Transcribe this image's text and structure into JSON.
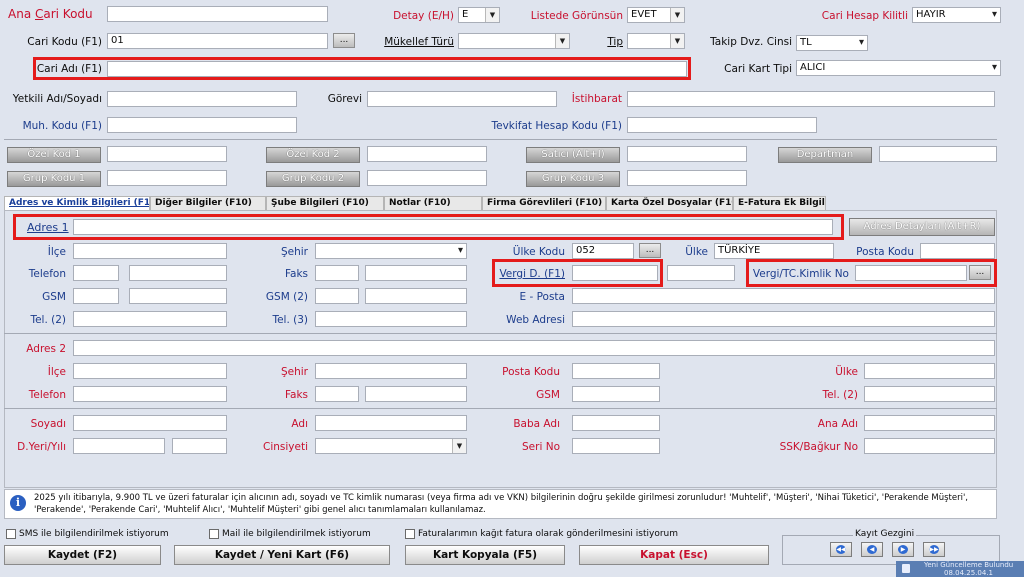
{
  "top": {
    "ana_cari_kodu": "Ana Cari Kodu",
    "ana_cari_kodu_accel": "C",
    "detay_label": "Detay (E/H)",
    "detay_value": "E",
    "listede_label": "Listede Görünsün",
    "listede_value": "EVET",
    "kilitli_label": "Cari Hesap Kilitli",
    "kilitli_value": "HAYIR",
    "cari_kodu_label": "Cari Kodu (F1)",
    "cari_kodu_value": "01",
    "dots": "...",
    "mukellef_label": "Mükellef Türü",
    "tip_label": "Tip",
    "takip_label": "Takip Dvz. Cinsi",
    "takip_value": "TL",
    "cari_adi_label": "Cari Adı (F1)",
    "kart_tipi_label": "Cari Kart Tipi",
    "kart_tipi_value": "ALICI",
    "yetkili_label": "Yetkili Adı/Soyadı",
    "gorevi_label": "Görevi",
    "istihbarat_label": "İstihbarat",
    "muh_kodu_label": "Muh. Kodu (F1)",
    "tevkifat_label": "Tevkifat Hesap Kodu (F1)",
    "ozel_kod_1": "Özel Kod 1",
    "ozel_kod_2": "Özel Kod 2",
    "satici": "Satıcı (Alt+I)",
    "departman": "Departman",
    "grup_kodu_1": "Grup Kodu 1",
    "grup_kodu_2": "Grup Kodu 2",
    "grup_kodu_3": "Grup Kodu 3"
  },
  "tabs": [
    "Adres ve Kimlik Bilgileri (F10)",
    "Diğer Bilgiler (F10)",
    "Şube Bilgileri (F10)",
    "Notlar (F10)",
    "Firma Görevlileri  (F10)",
    "Karta Özel Dosyalar (F10)",
    "E-Fatura Ek Bilgiler"
  ],
  "adres": {
    "adres1_label": "Adres 1",
    "adres_detay_button": "Adres Detayları (Alt+R)",
    "ilce_label": "İlçe",
    "sehir_label": "Şehir",
    "ulke_kodu_label": "Ülke Kodu",
    "ulke_kodu_value": "052",
    "ulke_label": "Ülke",
    "ulke_value": "TÜRKİYE",
    "posta_kodu_label": "Posta Kodu",
    "telefon_label": "Telefon",
    "faks_label": "Faks",
    "vergi_d_label": "Vergi D. (F1)",
    "vergi_tc_label": "Vergi/TC.Kimlik No",
    "gsm_label": "GSM",
    "gsm2_label": "GSM (2)",
    "eposta_label": "E - Posta",
    "tel2_label": "Tel. (2)",
    "tel3_label": "Tel. (3)",
    "web_label": "Web Adresi",
    "adres2_label": "Adres 2",
    "ilce2_label": "İlçe",
    "sehir2_label": "Şehir",
    "posta_kodu2_label": "Posta Kodu",
    "ulke2_label": "Ülke",
    "telefon2_label": "Telefon",
    "faks2_label": "Faks",
    "gsm3_label": "GSM",
    "tel2b_label": "Tel. (2)",
    "soyadi_label": "Soyadı",
    "adi_label": "Adı",
    "baba_adi_label": "Baba Adı",
    "ana_adi_label": "Ana Adı",
    "dyeri_label": "D.Yeri/Yılı",
    "cinsiyeti_label": "Cinsiyeti",
    "seri_no_label": "Seri No",
    "ssk_label": "SSK/Bağkur No"
  },
  "info": {
    "icon": "info-icon",
    "text": "2025 yılı itibarıyla, 9.900 TL ve üzeri faturalar için alıcının adı, soyadı ve TC kimlik numarası (veya firma adı ve VKN) bilgilerinin doğru şekilde girilmesi zorunludur! 'Muhtelif', 'Müşteri', 'Nihai Tüketici', 'Perakende Müşteri', 'Perakende', 'Perakende Cari', 'Muhtelif Alıcı', 'Muhtelif Müşteri' gibi genel alıcı tanımlamaları kullanılamaz."
  },
  "bottom": {
    "sms": "SMS ile bilgilendirilmek istiyorum",
    "mail": "Mail ile bilgilendirilmek istiyorum",
    "kagit": "Faturalarımın kağıt fatura olarak gönderilmesini istiyorum",
    "kayit_gezgini": "Kayıt Gezgini",
    "kaydet": "Kaydet (F2)",
    "kaydet_yeni": "Kaydet / Yeni Kart (F6)",
    "kopyala": "Kart Kopyala (F5)",
    "kapat": "Kapat (Esc)",
    "update_line1": "Yeni Güncelleme Bulundu",
    "update_line2": "08.04.25.04.1"
  },
  "colors": {
    "accent_red": "#c8102e",
    "label_blue": "#1c3c8c",
    "highlight": "#e41b1b"
  }
}
